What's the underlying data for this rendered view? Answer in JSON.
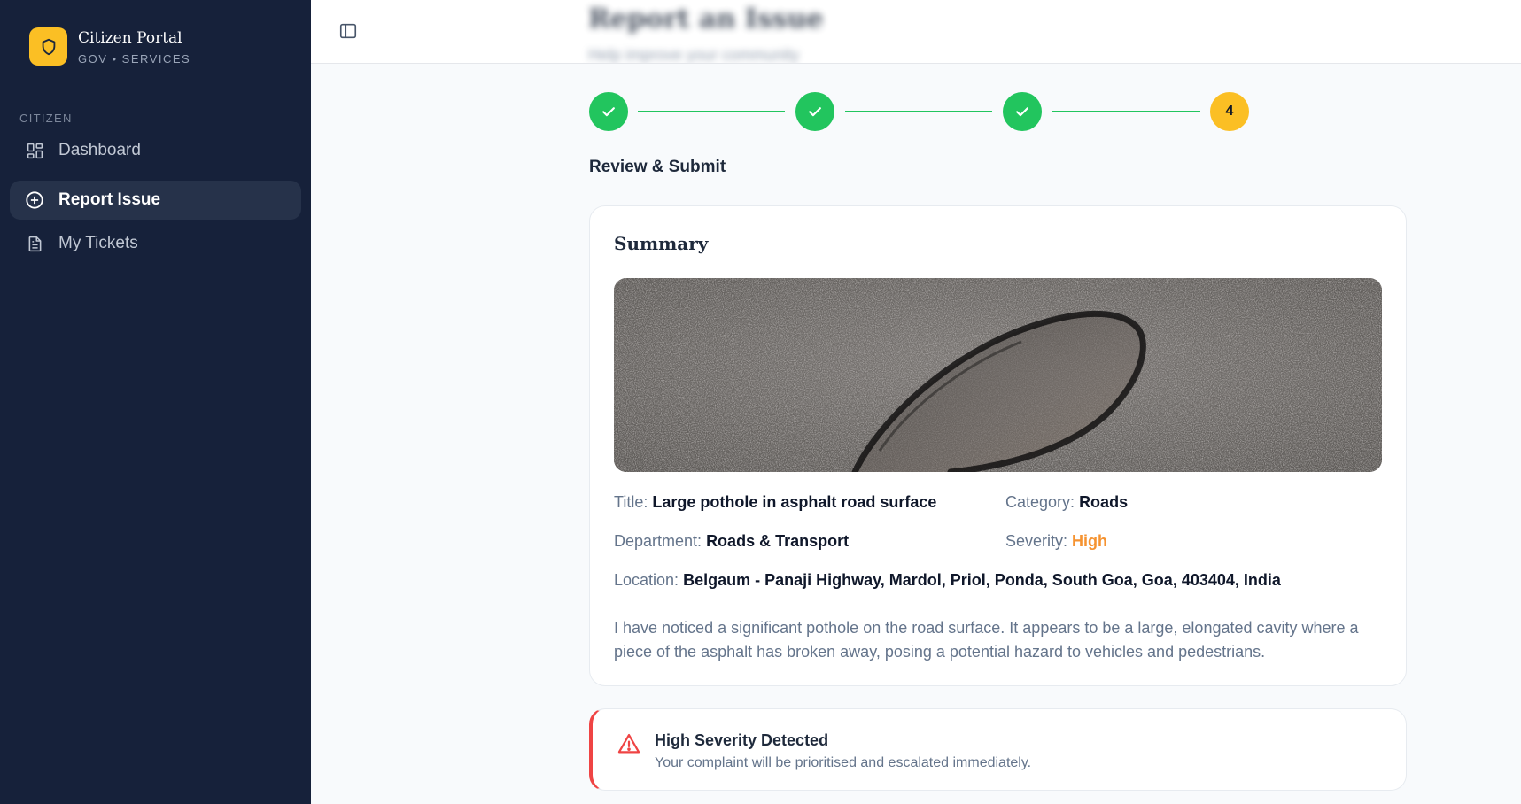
{
  "brand": {
    "title": "Citizen Portal",
    "subtitle": "GOV • SERVICES"
  },
  "sidebar": {
    "section": "CITIZEN",
    "items": [
      {
        "label": "Dashboard",
        "icon": "grid-icon",
        "active": false
      },
      {
        "label": "Report Issue",
        "icon": "plus-circle-icon",
        "active": true
      },
      {
        "label": "My Tickets",
        "icon": "file-icon",
        "active": false
      }
    ]
  },
  "header": {
    "title": "Report an Issue",
    "subtitle": "Help improve your community"
  },
  "stepper": {
    "current_step": 4,
    "total_steps": 4,
    "current_label": "4",
    "step_title": "Review & Submit"
  },
  "summary": {
    "heading": "Summary",
    "title_label": "Title:",
    "title_value": "Large pothole in asphalt road surface",
    "category_label": "Category:",
    "category_value": "Roads",
    "department_label": "Department:",
    "department_value": "Roads & Transport",
    "severity_label": "Severity:",
    "severity_value": "High",
    "location_label": "Location:",
    "location_value": "Belgaum - Panaji Highway, Mardol, Priol, Ponda, South Goa, Goa, 403404, India",
    "description": "I have noticed a significant pothole on the road surface. It appears to be a large, elongated cavity where a piece of the asphalt has broken away, posing a potential hazard to vehicles and pedestrians."
  },
  "alert": {
    "title": "High Severity Detected",
    "message": "Your complaint will be prioritised and escalated immediately."
  },
  "colors": {
    "sidebar_bg": "#16213a",
    "accent": "#fbbf24",
    "success": "#22c55e",
    "severity_high": "#f59331",
    "alert_border": "#ef4444"
  }
}
